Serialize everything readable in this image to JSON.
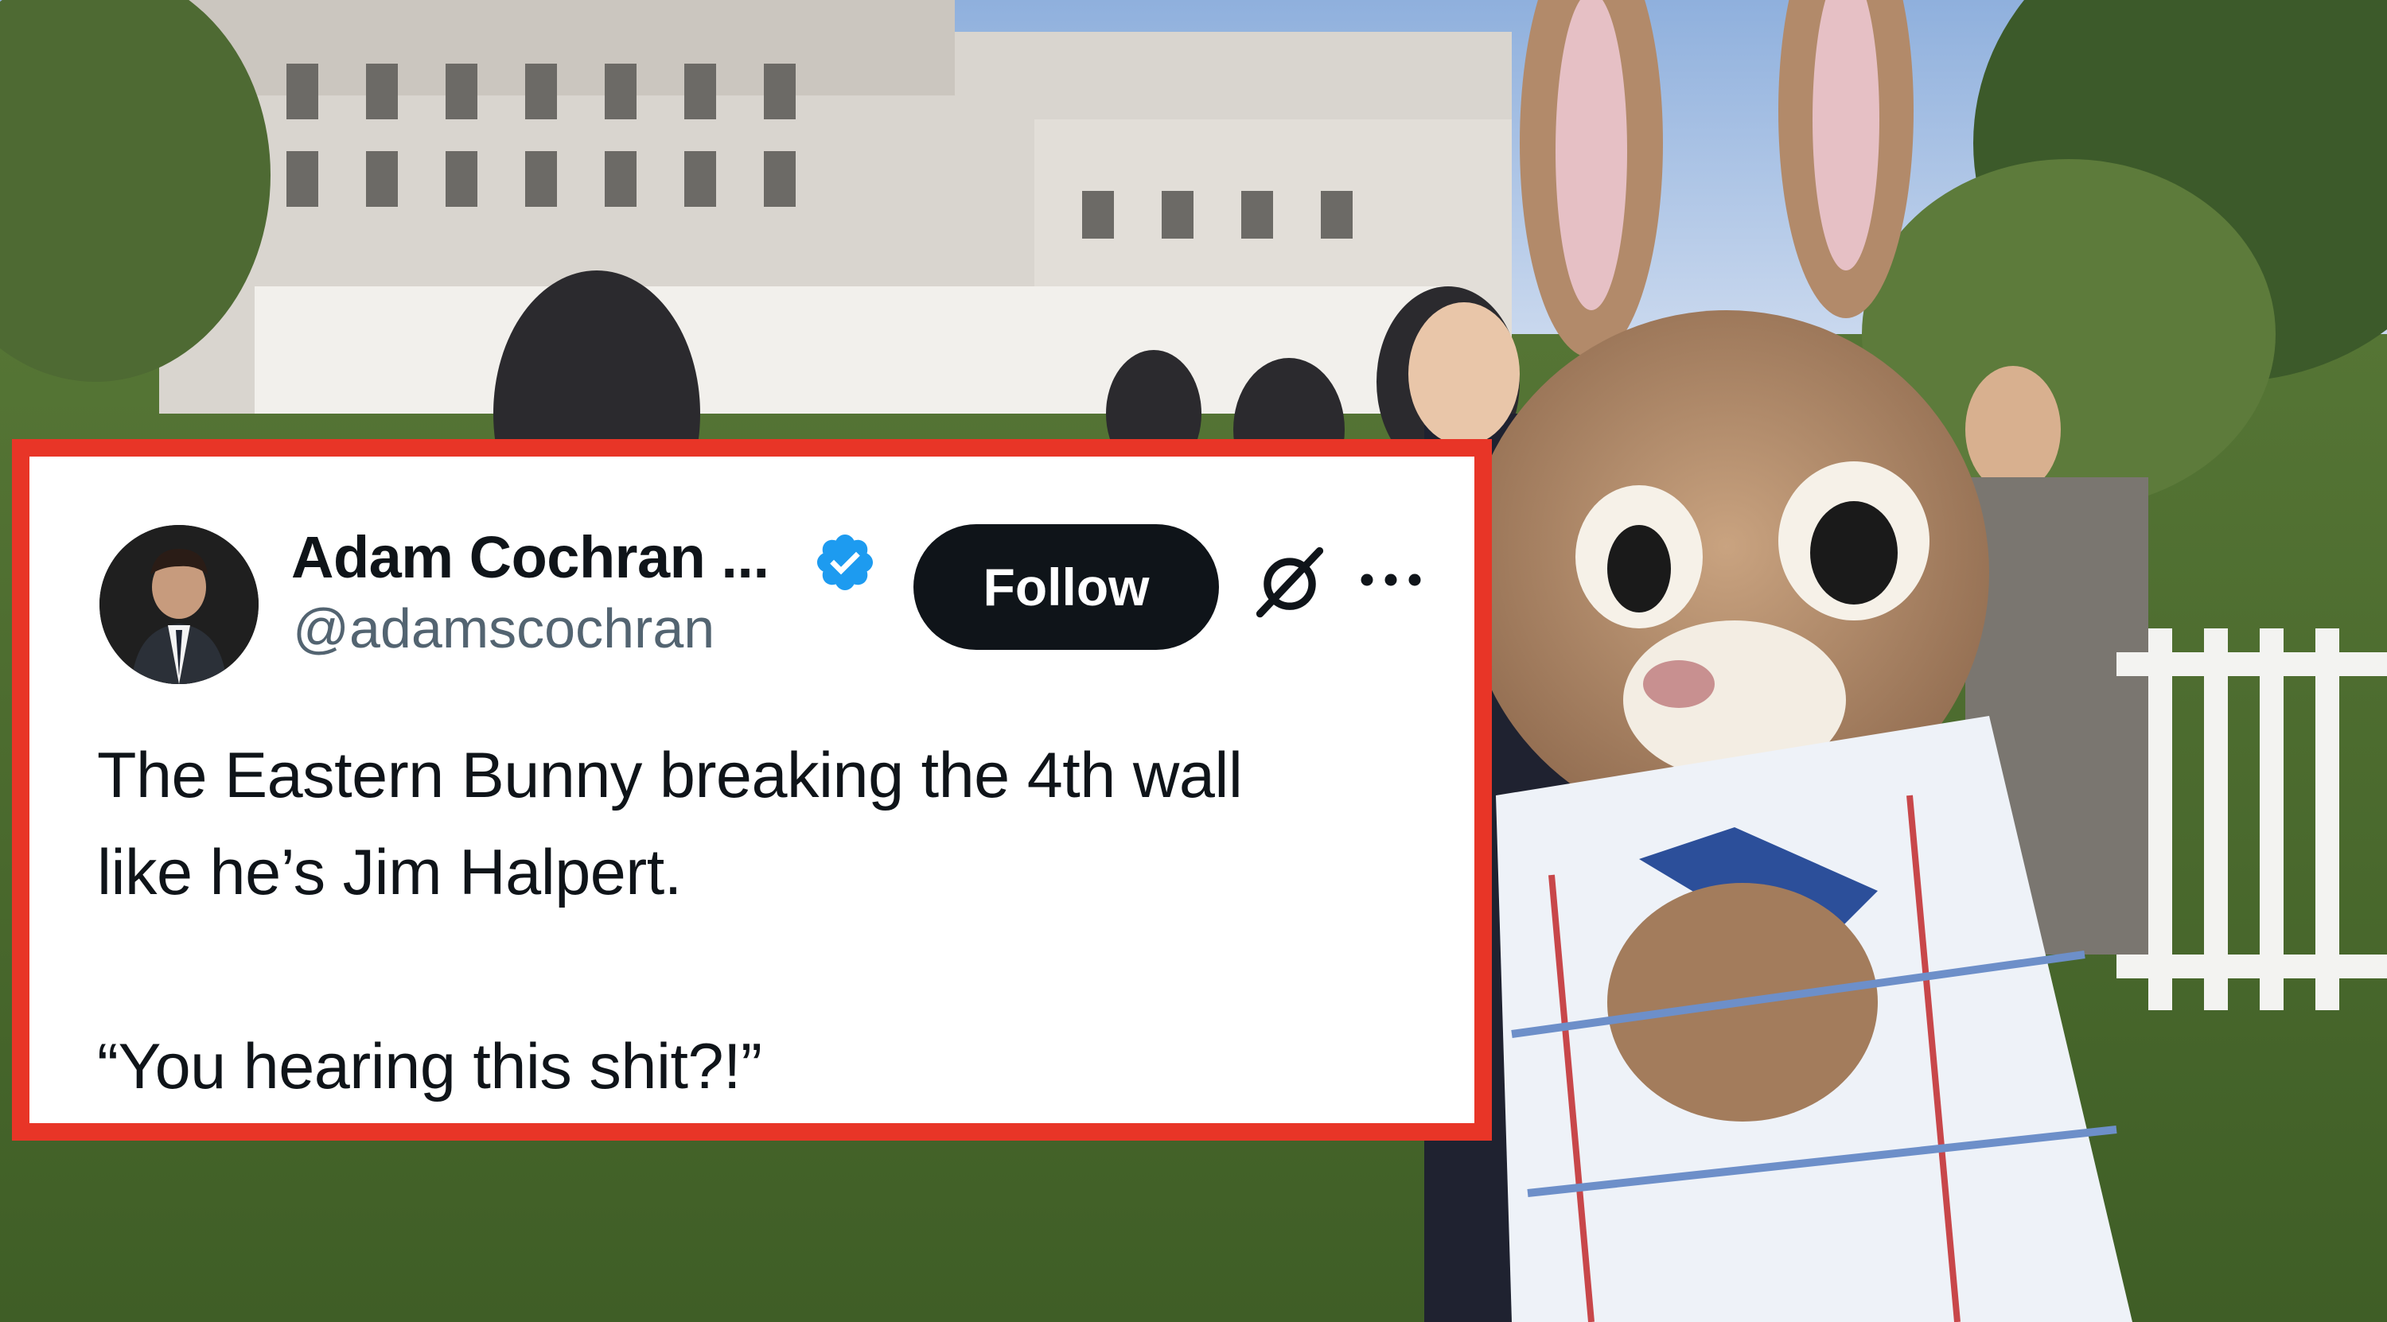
{
  "tweet": {
    "author_name": "Adam Cochran ...",
    "handle": "@adamscochran",
    "follow_label": "Follow",
    "verified_color": "#1d9bf0",
    "text_lines": [
      "The Eastern Bunny breaking the 4th wall",
      "like he’s Jim Halpert.",
      "“You hearing this shit?!”"
    ],
    "icons": {
      "verified": "verified-badge-icon",
      "logo": "x-logo-icon",
      "more": "more-options-icon"
    }
  },
  "colors": {
    "frame_border": "#e83527",
    "card_background": "#ffffff",
    "text_primary": "#0f1419",
    "text_secondary": "#536471",
    "follow_button_bg": "#0f1419"
  }
}
